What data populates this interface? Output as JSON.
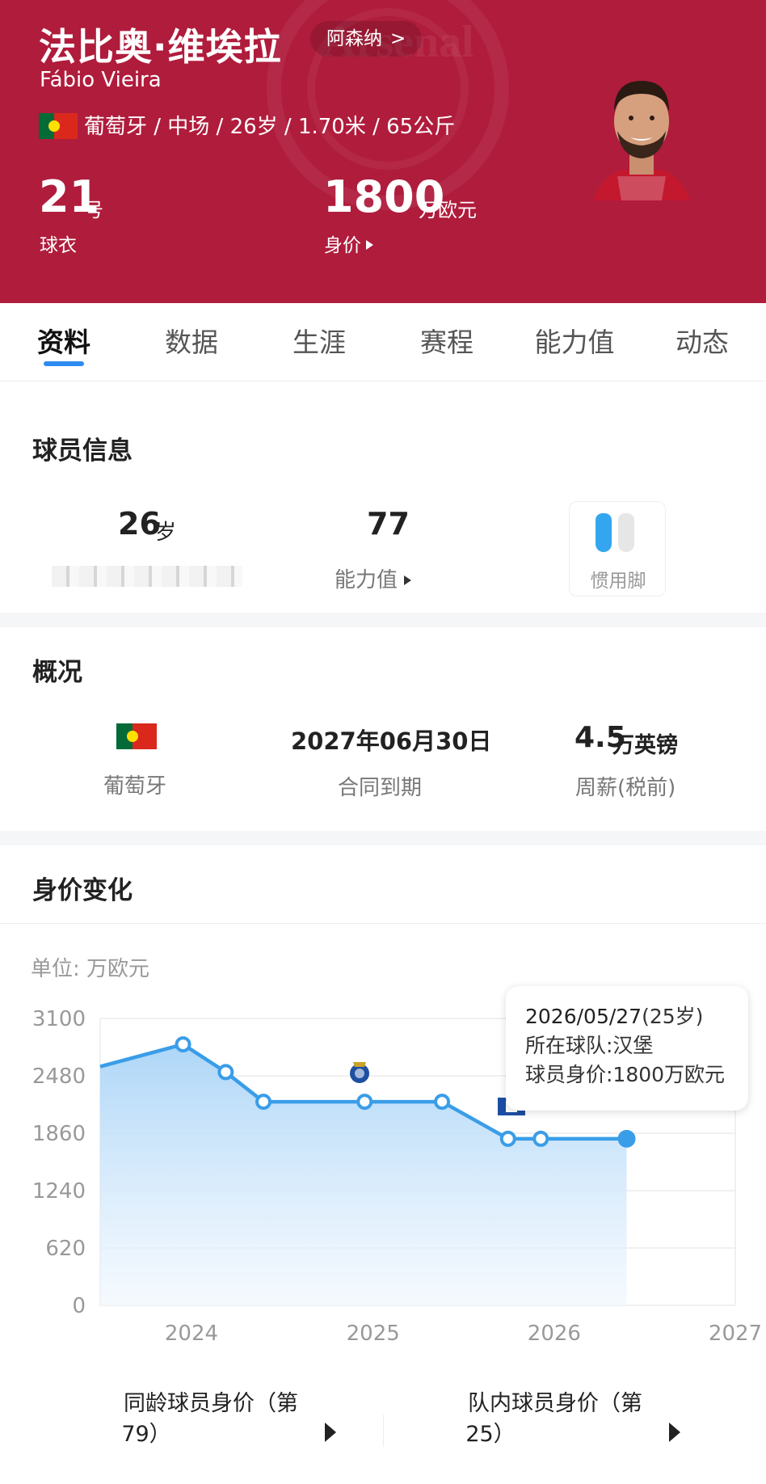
{
  "header": {
    "name_cn": "法比奥·维埃拉",
    "club": "阿森纳",
    "club_arrow": ">",
    "name_en": "Fábio Vieira",
    "bio": "葡萄牙 / 中场 / 26岁 / 1.70米 / 65公斤",
    "shirt_number": "21",
    "shirt_unit": "号",
    "shirt_label": "球衣",
    "market_value": "1800",
    "market_value_unit": "万欧元",
    "market_value_label": "身价",
    "watermark": "Arsenal"
  },
  "tabs": [
    {
      "label": "资料"
    },
    {
      "label": "数据"
    },
    {
      "label": "生涯"
    },
    {
      "label": "赛程"
    },
    {
      "label": "能力值"
    },
    {
      "label": "动态"
    }
  ],
  "player_info": {
    "title": "球员信息",
    "age": "26",
    "age_unit": "岁",
    "rating": "77",
    "rating_label": "能力值",
    "foot_label": "惯用脚"
  },
  "overview": {
    "title": "概况",
    "nationality": "葡萄牙",
    "contract_date": "2027年06月30日",
    "contract_label": "合同到期",
    "wage": "4.5",
    "wage_unit": "万英镑",
    "wage_label": "周薪(税前)"
  },
  "value_section": {
    "title": "身价变化",
    "unit_label": "单位:  万欧元"
  },
  "tooltip": {
    "date": "2026/05/27",
    "age": "(25岁)",
    "club_line": "所在球队:汉堡",
    "value_line": "球员身价:1800万欧元"
  },
  "chart_data": {
    "type": "area",
    "xlabel": "",
    "ylabel": "",
    "y_ticks": [
      0,
      620,
      1240,
      1860,
      2480,
      3100
    ],
    "x_ticks": [
      "2024",
      "2025",
      "2026",
      "2027"
    ],
    "ylim": [
      0,
      3100
    ],
    "x_range": [
      "2023-07-01",
      "2027-01-01"
    ],
    "series": [
      {
        "x": [
          "2023-07-01",
          "2023-12-15",
          "2024-03-10",
          "2024-05-25",
          "2024-12-15",
          "2025-05-20",
          "2025-09-30",
          "2025-12-05",
          "2026-05-27"
        ],
        "values": [
          2580,
          2820,
          2520,
          2200,
          2200,
          2200,
          1800,
          1800,
          1800
        ],
        "highlight_last": true
      }
    ],
    "colors": {
      "line": "#3a9de8",
      "fill_top": "#a9d4f7",
      "fill_bottom": "#eef6fe"
    },
    "grid": true
  },
  "rankings": {
    "same_age": "同龄球员身价（第79）",
    "same_age_line1": "同龄球员身价（第",
    "same_age_line2": "79）",
    "in_team_line1": "队内球员身价（第",
    "in_team_line2": "25）"
  }
}
